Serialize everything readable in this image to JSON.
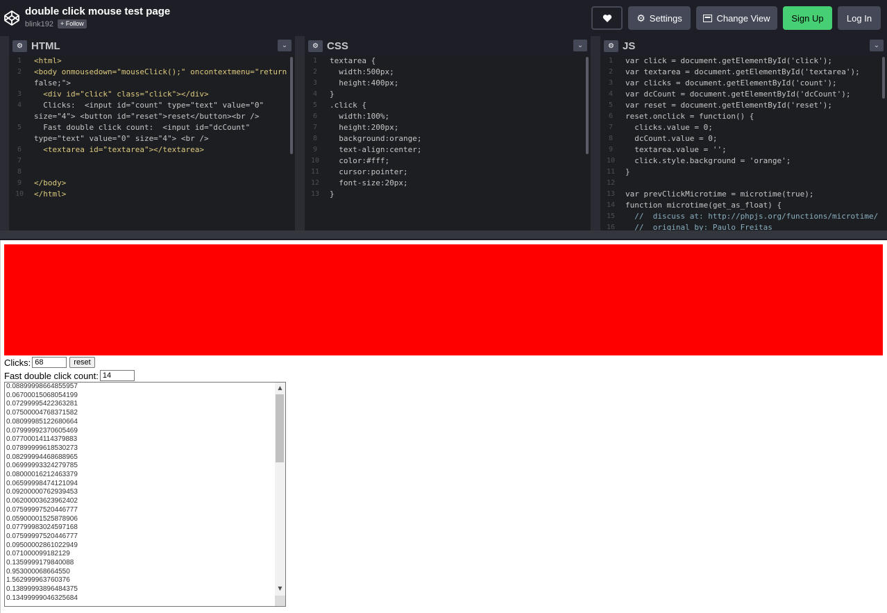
{
  "header": {
    "title": "double click mouse test page",
    "author": "blink192",
    "follow_label": "+ Follow",
    "buttons": {
      "like_icon": "heart-icon",
      "settings": "Settings",
      "settings_icon": "gear-icon",
      "change_view": "Change View",
      "change_view_icon": "layout-icon",
      "sign_up": "Sign Up",
      "log_in": "Log In"
    },
    "colors": {
      "bar": "#1e1f26",
      "button": "#444857",
      "signup": "#47cf73"
    }
  },
  "editors": [
    {
      "name": "HTML",
      "lines": [
        {
          "n": "1",
          "text": "<html>"
        },
        {
          "n": "2",
          "text": "<body onmousedown=\"mouseClick();\" oncontextmenu=\"return"
        },
        {
          "n": "",
          "text": "false;\">"
        },
        {
          "n": "3",
          "text": "  <div id=\"click\" class=\"click\"></div>"
        },
        {
          "n": "4",
          "text": "  Clicks:  <input id=\"count\" type=\"text\" value=\"0\""
        },
        {
          "n": "",
          "text": "size=\"4\"> <button id=\"reset\">reset</button><br />"
        },
        {
          "n": "5",
          "text": "  Fast double click count:  <input id=\"dcCount\""
        },
        {
          "n": "",
          "text": "type=\"text\" value=\"0\" size=\"4\"> <br />"
        },
        {
          "n": "6",
          "text": "  <textarea id=\"textarea\"></textarea>"
        },
        {
          "n": "7",
          "text": ""
        },
        {
          "n": "8",
          "text": ""
        },
        {
          "n": "9",
          "text": "</body>"
        },
        {
          "n": "10",
          "text": "</html>"
        }
      ]
    },
    {
      "name": "CSS",
      "lines": [
        {
          "n": "1",
          "text": "textarea {"
        },
        {
          "n": "2",
          "text": "  width:500px;"
        },
        {
          "n": "3",
          "text": "  height:400px;"
        },
        {
          "n": "4",
          "text": "}"
        },
        {
          "n": "5",
          "text": ".click {"
        },
        {
          "n": "6",
          "text": "  width:100%;"
        },
        {
          "n": "7",
          "text": "  height:200px;"
        },
        {
          "n": "8",
          "text": "  background:orange;"
        },
        {
          "n": "9",
          "text": "  text-align:center;"
        },
        {
          "n": "10",
          "text": "  color:#fff;"
        },
        {
          "n": "11",
          "text": "  cursor:pointer;"
        },
        {
          "n": "12",
          "text": "  font-size:20px;"
        },
        {
          "n": "13",
          "text": "}"
        }
      ]
    },
    {
      "name": "JS",
      "lines": [
        {
          "n": "1",
          "text": "var click = document.getElementById('click');"
        },
        {
          "n": "2",
          "text": "var textarea = document.getElementById('textarea');"
        },
        {
          "n": "3",
          "text": "var clicks = document.getElementById('count');"
        },
        {
          "n": "4",
          "text": "var dcCount = document.getElementById('dcCount');"
        },
        {
          "n": "5",
          "text": "var reset = document.getElementById('reset');"
        },
        {
          "n": "6",
          "text": "reset.onclick = function() {"
        },
        {
          "n": "7",
          "text": "  clicks.value = 0;"
        },
        {
          "n": "8",
          "text": "  dcCount.value = 0;"
        },
        {
          "n": "9",
          "text": "  textarea.value = '';"
        },
        {
          "n": "10",
          "text": "  click.style.background = 'orange';"
        },
        {
          "n": "11",
          "text": "}"
        },
        {
          "n": "12",
          "text": ""
        },
        {
          "n": "13",
          "text": "var prevClickMicrotime = microtime(true);"
        },
        {
          "n": "14",
          "text": "function microtime(get_as_float) {"
        },
        {
          "n": "15",
          "text": "  //  discuss at: http://phpjs.org/functions/microtime/"
        },
        {
          "n": "16",
          "text": "  //  original by: Paulo Freitas"
        }
      ]
    }
  ],
  "result": {
    "click_area_color": "#ff0000",
    "clicks_label": "Clicks:",
    "clicks_value": "68",
    "reset_label": "reset",
    "dc_label": "Fast double click count:",
    "dc_value": "14",
    "textarea_lines": [
      "0.08899998664855957",
      "0.06700015068054199",
      "0.07299995422363281",
      "0.07500004768371582",
      "0.08099985122680664",
      "0.07999992370605469",
      "0.07700014114379883",
      "0.07899999618530273",
      "0.08299994468688965",
      "0.06999993324279785",
      "0.08000016212463379",
      "0.06599998474121094",
      "0.09200000762939453",
      "0.06200003623962402",
      "0.07599997520446777",
      "0.05900001525878906",
      "0.07799983024597168",
      "0.07599997520446777",
      "0.09500002861022949",
      "0.071000099182129",
      "0.1359999179840088",
      "0.953000068664550",
      "1.562999963760376",
      "0.13899993896484375",
      "0.13499999046325684"
    ]
  }
}
